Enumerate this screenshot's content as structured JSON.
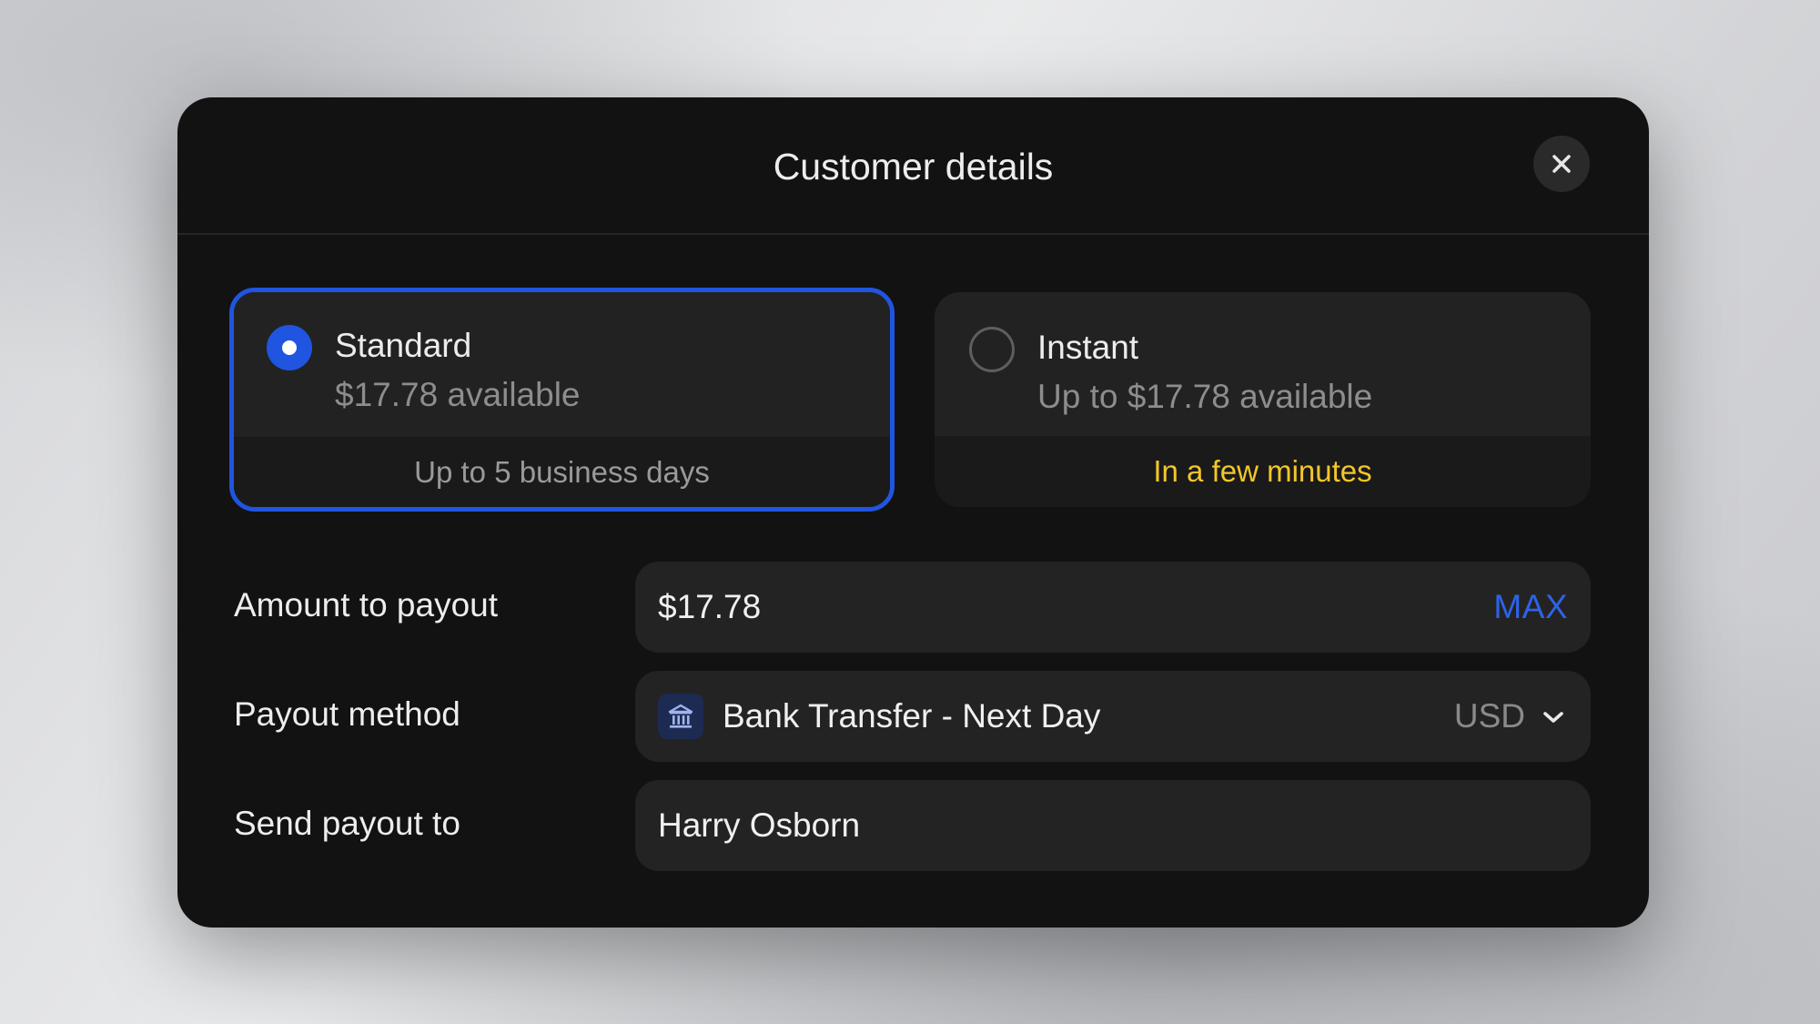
{
  "modal": {
    "title": "Customer details"
  },
  "options": {
    "standard": {
      "title": "Standard",
      "availability": "$17.78 available",
      "eta": "Up to 5 business days",
      "selected": true
    },
    "instant": {
      "title": "Instant",
      "availability": "Up to $17.78 available",
      "eta": "In a few minutes",
      "selected": false
    }
  },
  "form": {
    "amount": {
      "label": "Amount to payout",
      "value": "$17.78",
      "max_label": "MAX"
    },
    "method": {
      "label": "Payout method",
      "value": "Bank Transfer - Next Day",
      "currency": "USD",
      "icon": "bank-icon"
    },
    "recipient": {
      "label": "Send payout to",
      "value": "Harry Osborn"
    }
  },
  "colors": {
    "accent": "#1f55e0",
    "eta_highlight": "#f3c62a",
    "modal_bg": "#121212"
  }
}
